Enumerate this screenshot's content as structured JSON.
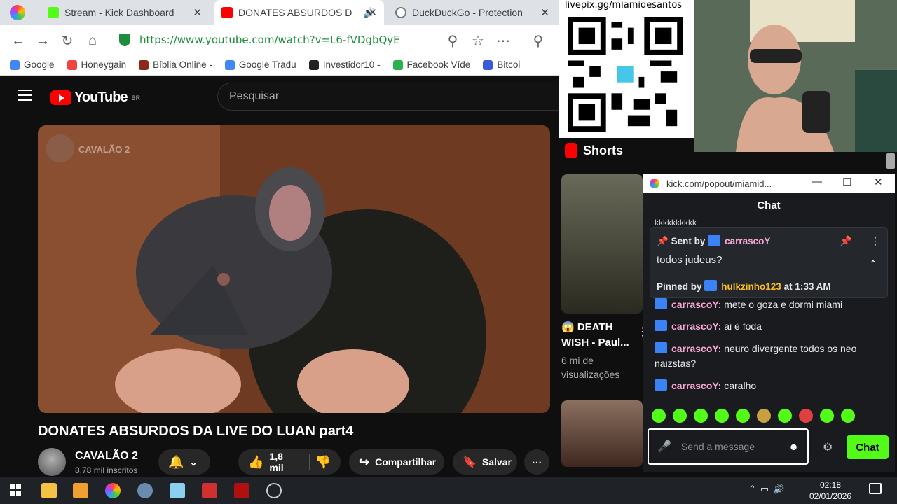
{
  "browser": {
    "tabs": [
      {
        "label": "Stream - Kick Dashboard",
        "fav_color": "#53fc18"
      },
      {
        "label": "DONATES ABSURDOS D",
        "fav_color": "#ff0000"
      },
      {
        "label": "DuckDuckGo - Protection",
        "fav_color": "#777777"
      }
    ],
    "url": "https://www.youtube.com/watch?v=L6-fVDgbQyE",
    "bookmarks": [
      "Google",
      "Honeygain",
      "Bíblia Online -",
      "Google Tradu",
      "Investidor10 -",
      "Facebook Víde",
      "Bitcoi"
    ]
  },
  "youtube": {
    "logo_text": "YouTube",
    "region": "BR",
    "search_placeholder": "Pesquisar",
    "video": {
      "watermark": "CAVALÃO 2",
      "title": "DONATES ABSURDOS DA LIVE DO LUAN part4",
      "channel": "CAVALÃO 2",
      "subscribers": "8,78 mil inscritos",
      "likes": "1,8 mil",
      "share_label": "Compartilhar",
      "save_label": "Salvar"
    },
    "shorts": {
      "heading": "Shorts",
      "items": [
        {
          "title": "😱 DEATH WISH - Paul...",
          "views": "6 mi de visualizações"
        }
      ]
    }
  },
  "overlay": {
    "qr_label": "livepix.gg/miamidesantos"
  },
  "kick_popout": {
    "window_title": "kick.com/popout/miamid...",
    "chat_title": "Chat",
    "truncated_top": "kkkkkkkkkk",
    "pinned": {
      "sent_by_label": "Sent by",
      "sender": "carrascoY",
      "message": "todos judeus?",
      "pinned_by_label": "Pinned by",
      "pinner": "hulkzinho123",
      "time": "at 1:33 AM"
    },
    "messages": [
      {
        "user": "carrascoY:",
        "text": "mete o goza e dormi miami"
      },
      {
        "user": "carrascoY:",
        "text": "ai é foda"
      },
      {
        "user": "carrascoY:",
        "text": "neuro divergente todos os neo naizstas?"
      },
      {
        "user": "carrascoY:",
        "text": "caralho"
      }
    ],
    "input_placeholder": "Send a message",
    "send_label": "Chat"
  },
  "taskbar": {
    "time": "02:18",
    "date": "02/01/2026"
  }
}
